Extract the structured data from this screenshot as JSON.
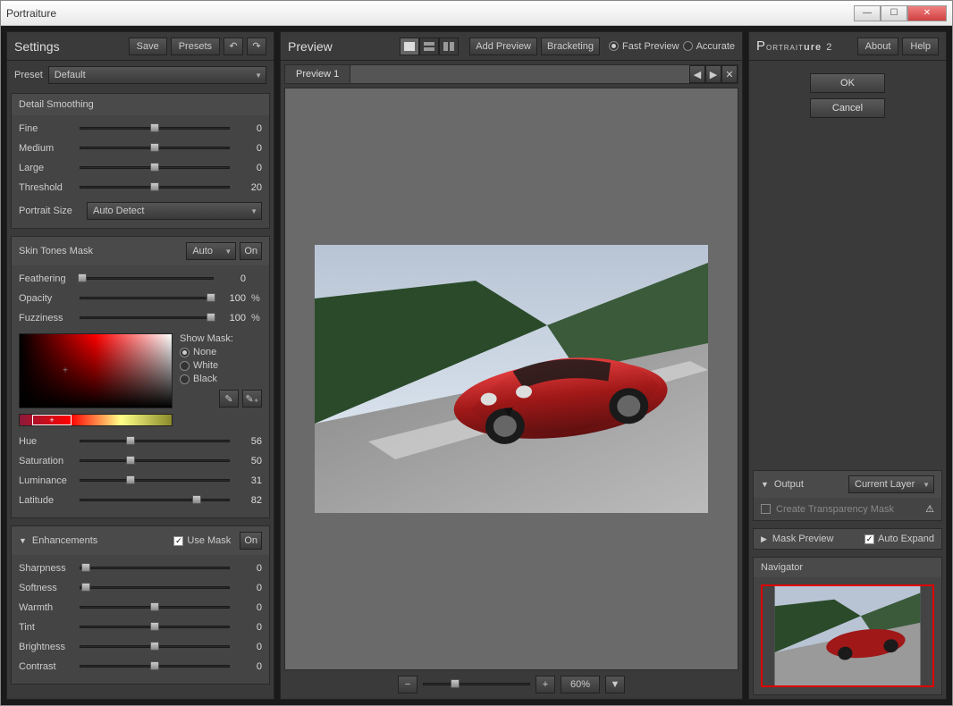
{
  "window": {
    "title": "Portraiture"
  },
  "brand": {
    "name": "Portraiture",
    "version": "2"
  },
  "left": {
    "title": "Settings",
    "save": "Save",
    "presets": "Presets",
    "preset_label": "Preset",
    "preset_value": "Default",
    "detail": {
      "title": "Detail Smoothing",
      "fine": {
        "label": "Fine",
        "value": 0,
        "pos": 50
      },
      "medium": {
        "label": "Medium",
        "value": 0,
        "pos": 50
      },
      "large": {
        "label": "Large",
        "value": 0,
        "pos": 50
      },
      "threshold": {
        "label": "Threshold",
        "value": 20,
        "pos": 50
      },
      "size_label": "Portrait Size",
      "size_value": "Auto Detect"
    },
    "mask": {
      "title": "Skin Tones Mask",
      "mode": "Auto",
      "toggle": "On",
      "feathering": {
        "label": "Feathering",
        "value": 0,
        "pos": 2
      },
      "opacity": {
        "label": "Opacity",
        "value": 100,
        "unit": "%",
        "pos": 98
      },
      "fuzziness": {
        "label": "Fuzziness",
        "value": 100,
        "unit": "%",
        "pos": 98
      },
      "show_mask": "Show Mask:",
      "opt_none": "None",
      "opt_white": "White",
      "opt_black": "Black",
      "hue": {
        "label": "Hue",
        "value": 56,
        "pos": 34
      },
      "saturation": {
        "label": "Saturation",
        "value": 50,
        "pos": 34
      },
      "luminance": {
        "label": "Luminance",
        "value": 31,
        "pos": 34
      },
      "latitude": {
        "label": "Latitude",
        "value": 82,
        "pos": 78
      }
    },
    "enh": {
      "title": "Enhancements",
      "use_mask": "Use Mask",
      "toggle": "On",
      "sharpness": {
        "label": "Sharpness",
        "value": 0,
        "pos": 4
      },
      "softness": {
        "label": "Softness",
        "value": 0,
        "pos": 4
      },
      "warmth": {
        "label": "Warmth",
        "value": 0,
        "pos": 50
      },
      "tint": {
        "label": "Tint",
        "value": 0,
        "pos": 50
      },
      "brightness": {
        "label": "Brightness",
        "value": 0,
        "pos": 50
      },
      "contrast": {
        "label": "Contrast",
        "value": 0,
        "pos": 50
      }
    }
  },
  "preview": {
    "title": "Preview",
    "add": "Add Preview",
    "bracketing": "Bracketing",
    "fast": "Fast Preview",
    "accurate": "Accurate",
    "tab": "Preview 1",
    "zoom": "60%"
  },
  "right": {
    "about": "About",
    "help": "Help",
    "ok": "OK",
    "cancel": "Cancel",
    "output": {
      "title": "Output",
      "target": "Current Layer",
      "transparency": "Create Transparency Mask"
    },
    "maskprev": {
      "title": "Mask Preview",
      "auto_expand": "Auto Expand"
    },
    "navigator": "Navigator"
  }
}
